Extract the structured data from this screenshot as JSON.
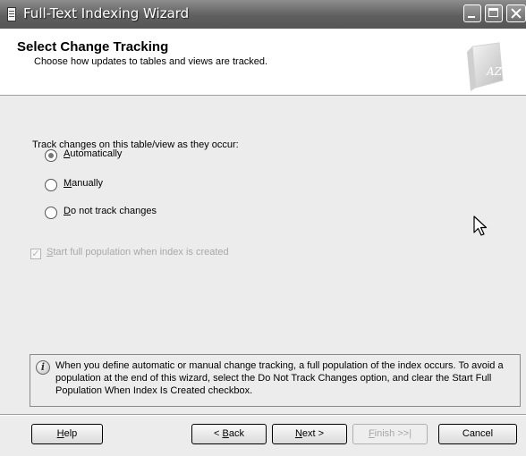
{
  "window": {
    "title": "Full-Text Indexing Wizard"
  },
  "header": {
    "title": "Select Change Tracking",
    "subtitle": "Choose how updates to tables and views are tracked.",
    "icon": "book-az-icon",
    "icon_text": "AZ"
  },
  "body": {
    "prompt": "Track changes on this table/view as they occur:",
    "options": [
      {
        "label": "Automatically",
        "accel": "A",
        "rest": "utomatically",
        "selected": true
      },
      {
        "label": "Manually",
        "accel": "M",
        "rest": "anually",
        "selected": false
      },
      {
        "label": "Do not track changes",
        "accel": "D",
        "rest": "o not track changes",
        "selected": false
      }
    ],
    "checkbox": {
      "label": "Start full population when index is created",
      "accel": "S",
      "rest": "tart full population when index is created",
      "checked": true,
      "disabled": true
    }
  },
  "info": {
    "icon": "info-icon",
    "text": "When you define automatic or manual change tracking, a full population of the index occurs. To avoid a population at the end of this wizard, select the Do Not Track Changes option, and clear the Start Full Population When Index Is Created checkbox."
  },
  "buttons": {
    "help": {
      "accel": "H",
      "rest": "elp"
    },
    "back": {
      "pre": "< ",
      "accel": "B",
      "rest": "ack"
    },
    "next": {
      "accel": "N",
      "rest": "ext >"
    },
    "finish": {
      "accel": "F",
      "rest": "inish >>|",
      "disabled": true
    },
    "cancel": {
      "label": "Cancel"
    }
  }
}
